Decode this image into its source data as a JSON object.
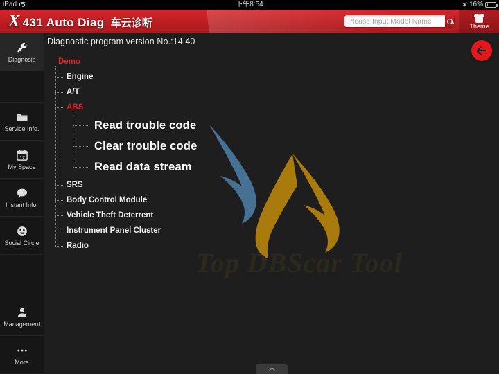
{
  "status_bar": {
    "device": "iPad",
    "wifi_icon": "wifi-icon",
    "time": "下午8:54",
    "bluetooth_icon": "bluetooth-icon",
    "battery_percent": "16%",
    "battery_icon": "battery-icon"
  },
  "header": {
    "logo_x": "X",
    "logo_en": "431 Auto Diag",
    "logo_cn": "车云诊断",
    "search": {
      "placeholder": "Please Input Model Name",
      "value": "",
      "button_icon": "search-icon"
    },
    "theme": {
      "label": "Theme",
      "icon": "tshirt-icon"
    },
    "colors": {
      "red_top": "#d4262b",
      "red_bottom": "#a81a1d"
    }
  },
  "sidebar": {
    "items": [
      {
        "label": "Diagnosis",
        "icon": "wrench-icon",
        "active": true
      },
      {
        "label": "Service Info.",
        "icon": "folder-icon",
        "active": false
      },
      {
        "label": "My Space",
        "icon": "calendar-icon",
        "active": false
      },
      {
        "label": "Instant Info.",
        "icon": "speech-bubble-icon",
        "active": false
      },
      {
        "label": "Social Circle",
        "icon": "smiley-icon",
        "active": false
      }
    ],
    "bottom_items": [
      {
        "label": "Management",
        "icon": "person-icon"
      },
      {
        "label": "More",
        "icon": "ellipsis-icon"
      }
    ]
  },
  "main": {
    "version_text": "Diagnostic program version No.:14.40",
    "back_button_icon": "arrow-left-icon",
    "back_button_color": "#e3181d",
    "watermark_text": "Top DBScar Tool",
    "watermark_wing_colors": {
      "left": "#4a7ba0",
      "right": "#b8860b"
    },
    "tree": {
      "root": {
        "label": "Demo",
        "color": "#e2211f"
      },
      "children": [
        {
          "label": "Engine",
          "selected": false
        },
        {
          "label": "A/T",
          "selected": false
        },
        {
          "label": "ABS",
          "selected": true,
          "children": [
            {
              "label": "Read trouble code"
            },
            {
              "label": "Clear trouble code"
            },
            {
              "label": "Read data stream"
            }
          ]
        },
        {
          "label": "SRS",
          "selected": false
        },
        {
          "label": "Body Control Module",
          "selected": false
        },
        {
          "label": "Vehicle Theft Deterrent",
          "selected": false
        },
        {
          "label": "Instrument Panel Cluster",
          "selected": false
        },
        {
          "label": "Radio",
          "selected": false
        }
      ]
    }
  },
  "bottom_bar": {
    "handle_icon": "chevron-up-icon"
  }
}
